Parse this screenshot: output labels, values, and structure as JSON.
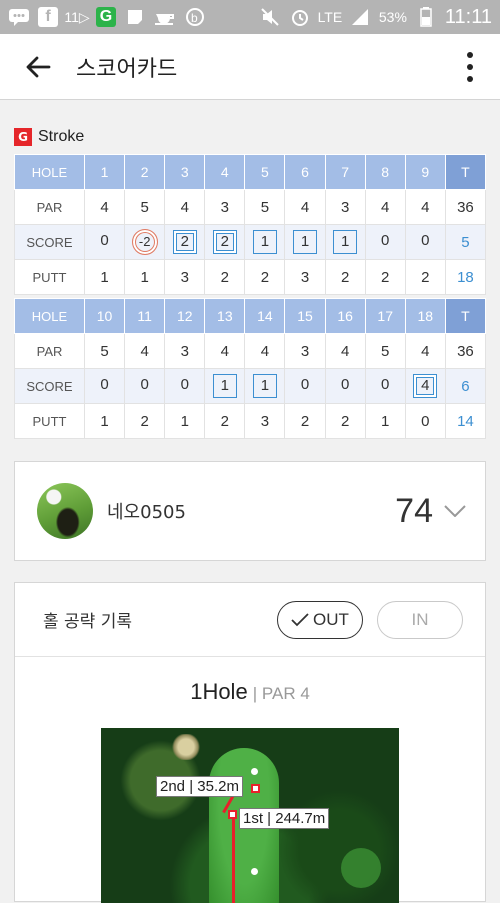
{
  "status_bar": {
    "carrier_count": "11▷",
    "network": "LTE",
    "battery": "53%",
    "time": "11:11"
  },
  "app_bar": {
    "title": "스코어카드"
  },
  "scorecard": {
    "mode_badge": "G",
    "mode_label": "Stroke",
    "labels": {
      "hole": "HOLE",
      "par": "PAR",
      "score": "SCORE",
      "putt": "PUTT",
      "total": "T"
    },
    "front": {
      "holes": [
        "1",
        "2",
        "3",
        "4",
        "5",
        "6",
        "7",
        "8",
        "9"
      ],
      "par": [
        "4",
        "5",
        "4",
        "3",
        "5",
        "4",
        "3",
        "4",
        "4"
      ],
      "score": [
        "0",
        "-2",
        "2",
        "2",
        "1",
        "1",
        "1",
        "0",
        "0"
      ],
      "putt": [
        "1",
        "1",
        "3",
        "2",
        "2",
        "3",
        "2",
        "2",
        "2"
      ],
      "par_total": "36",
      "score_total": "5",
      "putt_total": "18"
    },
    "back": {
      "holes": [
        "10",
        "11",
        "12",
        "13",
        "14",
        "15",
        "16",
        "17",
        "18"
      ],
      "par": [
        "5",
        "4",
        "3",
        "4",
        "4",
        "3",
        "4",
        "5",
        "4"
      ],
      "score": [
        "0",
        "0",
        "0",
        "1",
        "1",
        "0",
        "0",
        "0",
        "4"
      ],
      "putt": [
        "1",
        "2",
        "1",
        "2",
        "3",
        "2",
        "2",
        "1",
        "0"
      ],
      "par_total": "36",
      "score_total": "6",
      "putt_total": "14"
    }
  },
  "player": {
    "name": "네오0505",
    "total_score": "74"
  },
  "hole_record": {
    "title": "홀 공략 기록",
    "out_label": "OUT",
    "in_label": "IN",
    "selected": "OUT",
    "hole_label": "1Hole",
    "par_label": "| PAR 4",
    "shots": [
      {
        "label": "2nd | 35.2m"
      },
      {
        "label": "1st | 244.7m"
      }
    ]
  },
  "colors": {
    "header_blue": "#a3bde6",
    "total_blue": "#7fa0d6",
    "score_accent": "#3c8fd1",
    "eagle_ring": "#e07a62",
    "shot_line": "#e8202a"
  }
}
